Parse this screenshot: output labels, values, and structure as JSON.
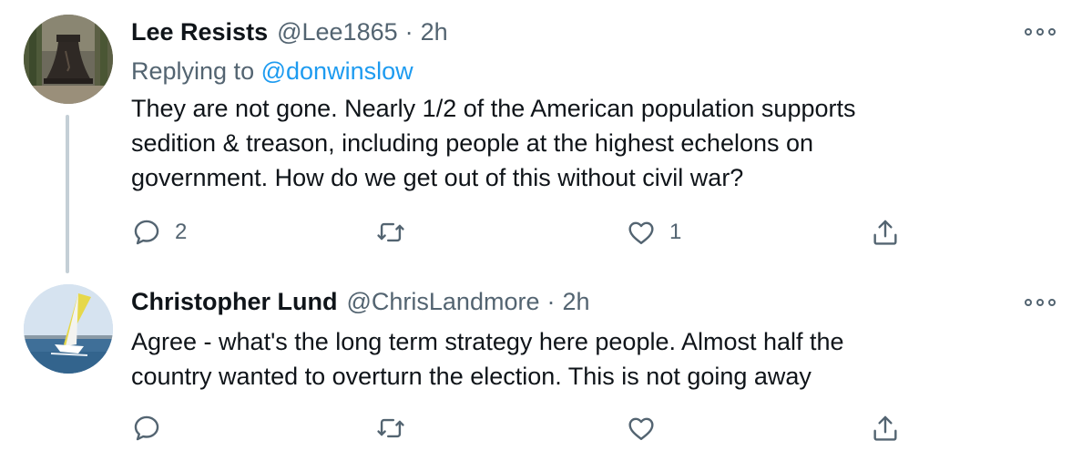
{
  "tweets": [
    {
      "display_name": "Lee Resists",
      "handle": "@Lee1865",
      "separator": "·",
      "time": "2h",
      "replying_prefix": "Replying to",
      "replying_mention": "@donwinslow",
      "text": "They are not gone. Nearly 1/2 of the American population supports\nsedition & treason, including people at the highest echelons on\ngovernment. How do we get out of this without civil war?",
      "avatar_icon": "liberty-bell-avatar",
      "actions": {
        "reply_count": "2",
        "retweet_count": "",
        "like_count": "1"
      }
    },
    {
      "display_name": "Christopher Lund",
      "handle": "@ChrisLandmore",
      "separator": "·",
      "time": "2h",
      "text": "Agree - what's the long term strategy here people. Almost half the\ncountry wanted to overturn the election. This is not going away",
      "avatar_icon": "sailboat-avatar",
      "actions": {
        "reply_count": "",
        "retweet_count": "",
        "like_count": ""
      }
    }
  ],
  "colors": {
    "text_primary": "#0f1419",
    "text_secondary": "#536471",
    "link": "#1d9bf0",
    "thread_line": "#c4cfd6"
  }
}
